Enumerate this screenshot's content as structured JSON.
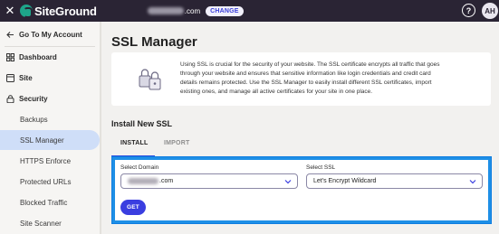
{
  "topbar": {
    "close_icon": "close-icon",
    "logo_text": "SiteGround",
    "domain_suffix": ".com",
    "change_label": "CHANGE",
    "help_label": "?",
    "avatar_initials": "AH"
  },
  "sidebar": {
    "back_label": "Go To My Account",
    "items": [
      {
        "label": "Dashboard",
        "icon": "dashboard-icon"
      },
      {
        "label": "Site",
        "icon": "site-icon"
      },
      {
        "label": "Security",
        "icon": "security-icon"
      }
    ],
    "sub_items": [
      "Backups",
      "SSL Manager",
      "HTTPS Enforce",
      "Protected URLs",
      "Blocked Traffic",
      "Site Scanner"
    ],
    "active_item": "SSL Manager"
  },
  "main": {
    "title": "SSL Manager",
    "info_line1": "Using SSL is crucial for the security of your website. The SSL certificate encrypts all traffic that goes",
    "info_line2": "through your website and ensures that sensitive information like login credentials and credit card",
    "info_line3": "details remains protected. Use the SSL Manager to easily install different SSL certificates, import",
    "info_line4": "existing ones, and manage all active certificates for your site in one place.",
    "section_title": "Install New SSL",
    "tabs": [
      {
        "label": "INSTALL",
        "active": true
      },
      {
        "label": "IMPORT",
        "active": false
      }
    ],
    "form": {
      "domain_label": "Select Domain",
      "domain_suffix": ".com",
      "ssl_label": "Select SSL",
      "ssl_value": "Let's Encrypt Wildcard",
      "get_label": "GET"
    }
  },
  "colors": {
    "topbar": "#2a2434",
    "accent": "#3a3ee0",
    "active_item": "#cfdef8",
    "highlight_border": "#1e8fe6"
  }
}
